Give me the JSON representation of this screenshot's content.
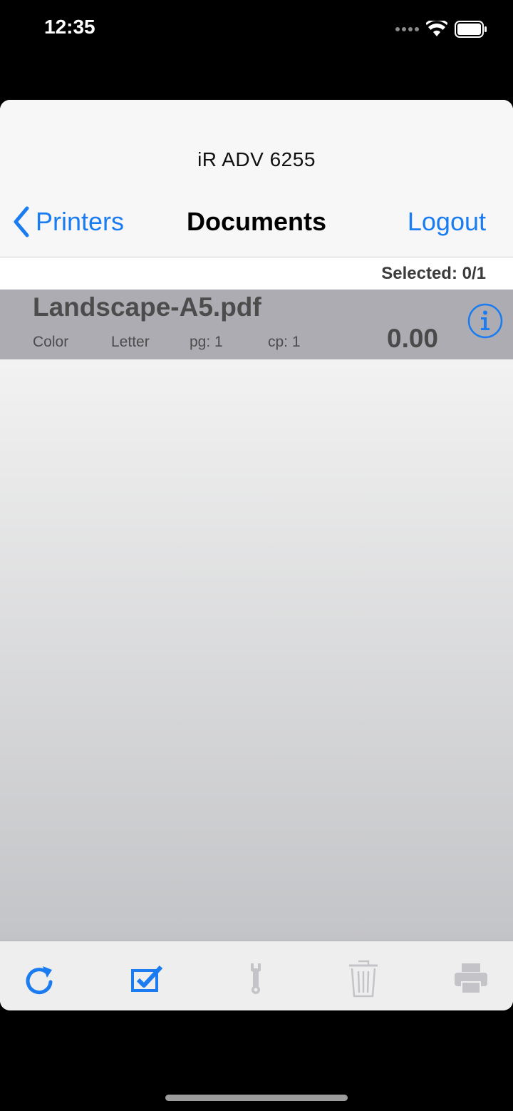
{
  "status_bar": {
    "time": "12:35"
  },
  "header": {
    "printer_name": "iR ADV 6255",
    "back_label": "Printers",
    "title": "Documents",
    "logout_label": "Logout"
  },
  "selection": {
    "label": "Selected: 0/1"
  },
  "documents": [
    {
      "name": "Landscape-A5.pdf",
      "color": "Color",
      "paper": "Letter",
      "pages": "pg: 1",
      "copies": "cp: 1",
      "cost": "0.00"
    }
  ],
  "toolbar": {
    "icons": [
      "refresh-icon",
      "select-all-icon",
      "settings-wrench-icon",
      "trash-icon",
      "print-icon"
    ],
    "enabled": [
      true,
      true,
      false,
      false,
      false
    ]
  },
  "colors": {
    "accent": "#1a7cf0",
    "row_background": "#aeacb3",
    "disabled_icon": "#c4c4c8"
  }
}
